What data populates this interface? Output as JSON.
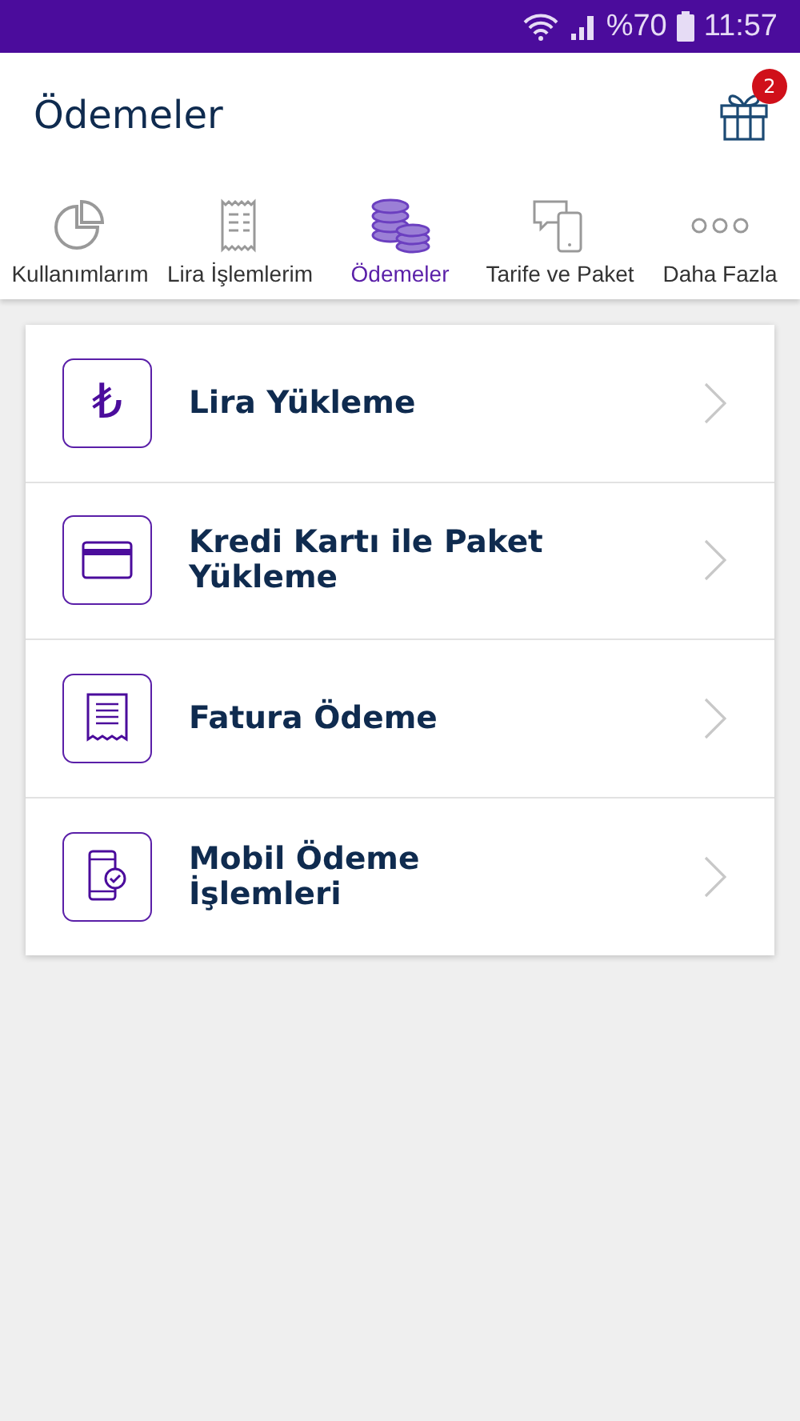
{
  "status_bar": {
    "battery": "%70",
    "time": "11:57"
  },
  "header": {
    "title": "Ödemeler",
    "gift_badge": "2"
  },
  "tabs": [
    {
      "label": "Kullanımlarım",
      "kind": "pie",
      "selected": false
    },
    {
      "label": "Lira İşlemlerim",
      "kind": "receipt",
      "selected": false
    },
    {
      "label": "Ödemeler",
      "kind": "coins",
      "selected": true
    },
    {
      "label": "Tarife ve Paket",
      "kind": "chat",
      "selected": false
    },
    {
      "label": "Daha Fazla",
      "kind": "dots",
      "selected": false
    }
  ],
  "menu": [
    {
      "label": "Lira Yükleme",
      "kind": "lira",
      "glyph": "₺"
    },
    {
      "label": "Kredi Kartı ile Paket Yükleme",
      "kind": "card"
    },
    {
      "label": "Fatura Ödeme",
      "kind": "bill"
    },
    {
      "label": "Mobil Ödeme İşlemleri",
      "kind": "mobile"
    }
  ]
}
